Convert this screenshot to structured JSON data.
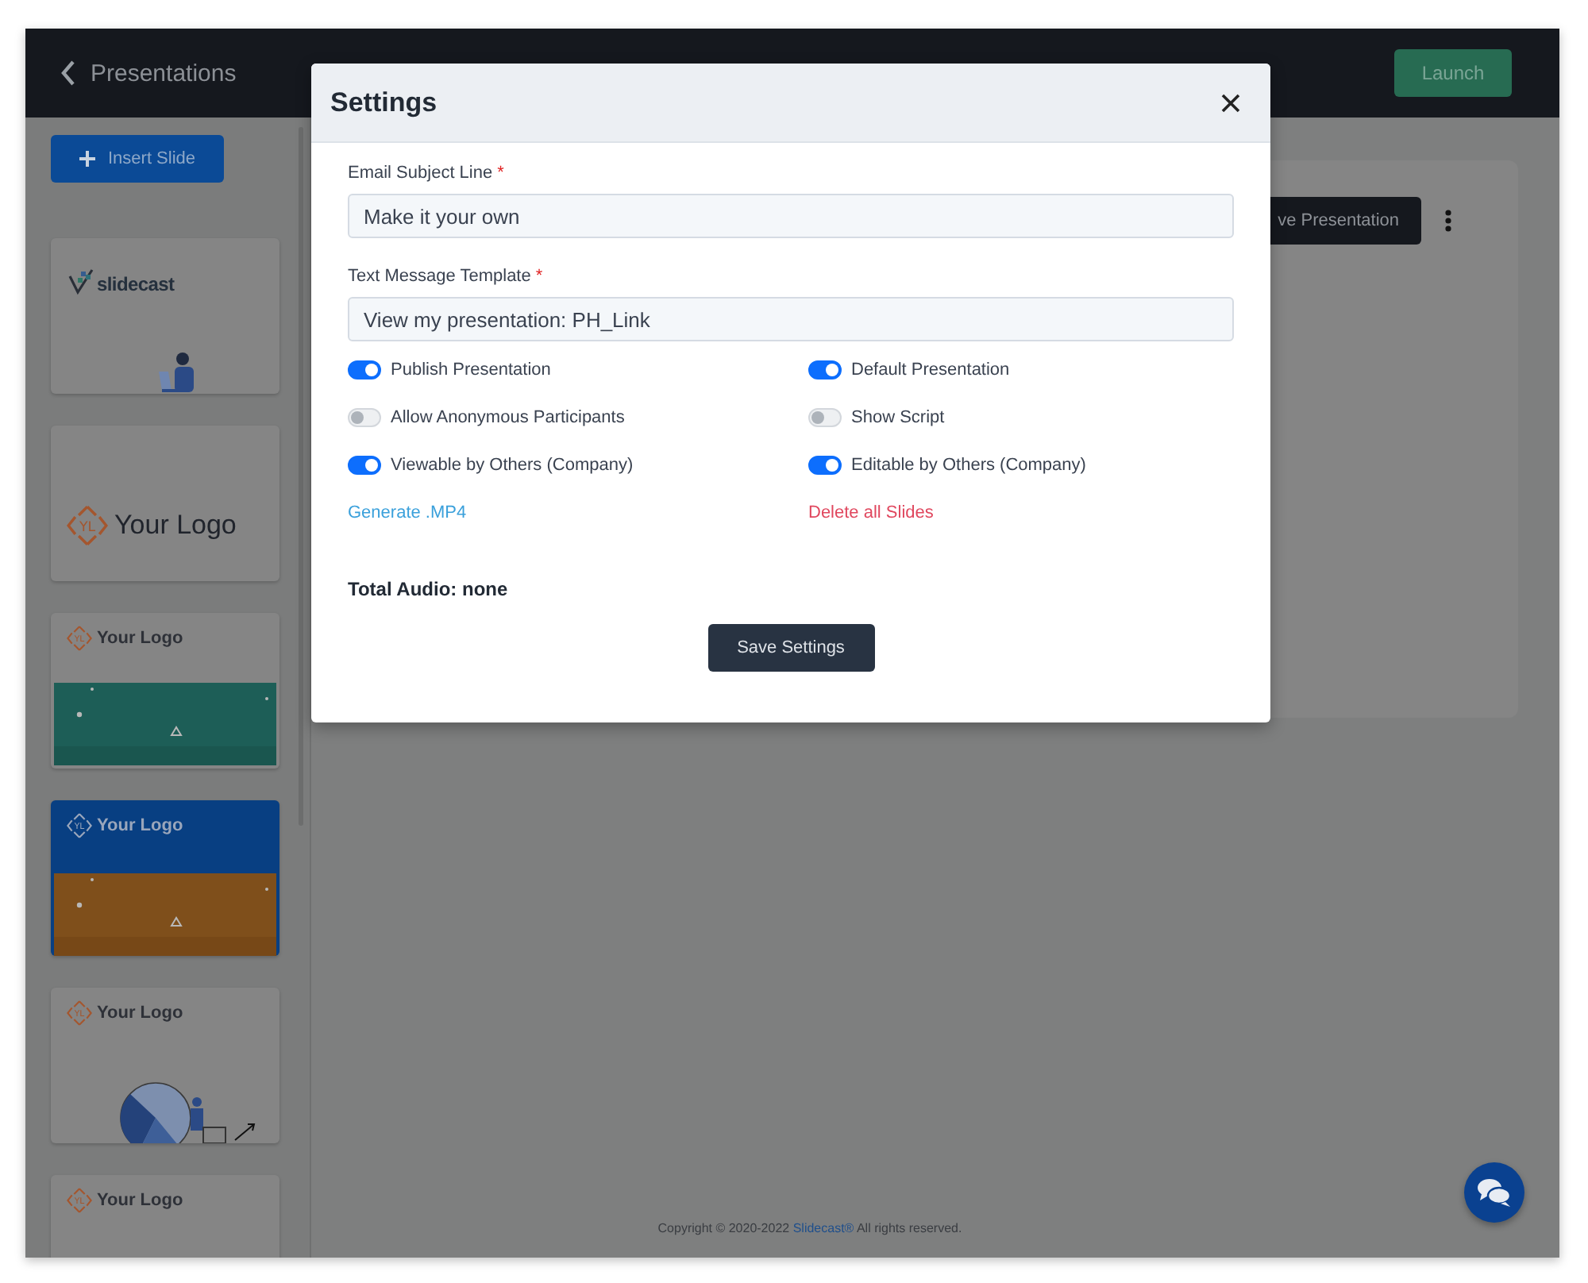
{
  "header": {
    "back_label": "Presentations",
    "launch_button": "Launch"
  },
  "sidebar": {
    "insert_button": "Insert Slide",
    "slides": [
      {
        "kind": "brand",
        "text": "slidecast",
        "selected": false
      },
      {
        "kind": "logo-large",
        "mark": "YL",
        "text": "Your Logo",
        "selected": false
      },
      {
        "kind": "logo-teal",
        "mark": "YL",
        "text": "Your Logo",
        "selected": false
      },
      {
        "kind": "logo-orange",
        "mark": "YL",
        "text": "Your Logo",
        "selected": true
      },
      {
        "kind": "logo-chart",
        "mark": "YL",
        "text": "Your Logo",
        "selected": false
      },
      {
        "kind": "logo-plain",
        "mark": "YL",
        "text": "Your Logo",
        "selected": false
      }
    ]
  },
  "editor": {
    "save_button": "ve Presentation"
  },
  "footer": {
    "copyright_before": "Copyright © 2020-2022",
    "company_link": "Slidecast®",
    "copyright_after": "All rights reserved."
  },
  "modal": {
    "title": "Settings",
    "fields": [
      {
        "label": "Email Subject Line",
        "required_mark": "*",
        "value": "Make it your own"
      },
      {
        "label": "Text Message Template",
        "required_mark": "*",
        "value": "View my presentation: PH_Link"
      }
    ],
    "toggles": [
      {
        "label": "Publish Presentation",
        "on": true
      },
      {
        "label": "Default Presentation",
        "on": true
      },
      {
        "label": "Allow Anonymous Participants",
        "on": false
      },
      {
        "label": "Show Script",
        "on": false
      },
      {
        "label": "Viewable by Others (Company)",
        "on": true
      },
      {
        "label": "Editable by Others (Company)",
        "on": true
      }
    ],
    "links": [
      {
        "label": "Generate .MP4",
        "kind": "action"
      },
      {
        "label": "Delete all Slides",
        "kind": "danger"
      }
    ],
    "total_audio": "Total Audio: none",
    "save_button": "Save Settings"
  }
}
